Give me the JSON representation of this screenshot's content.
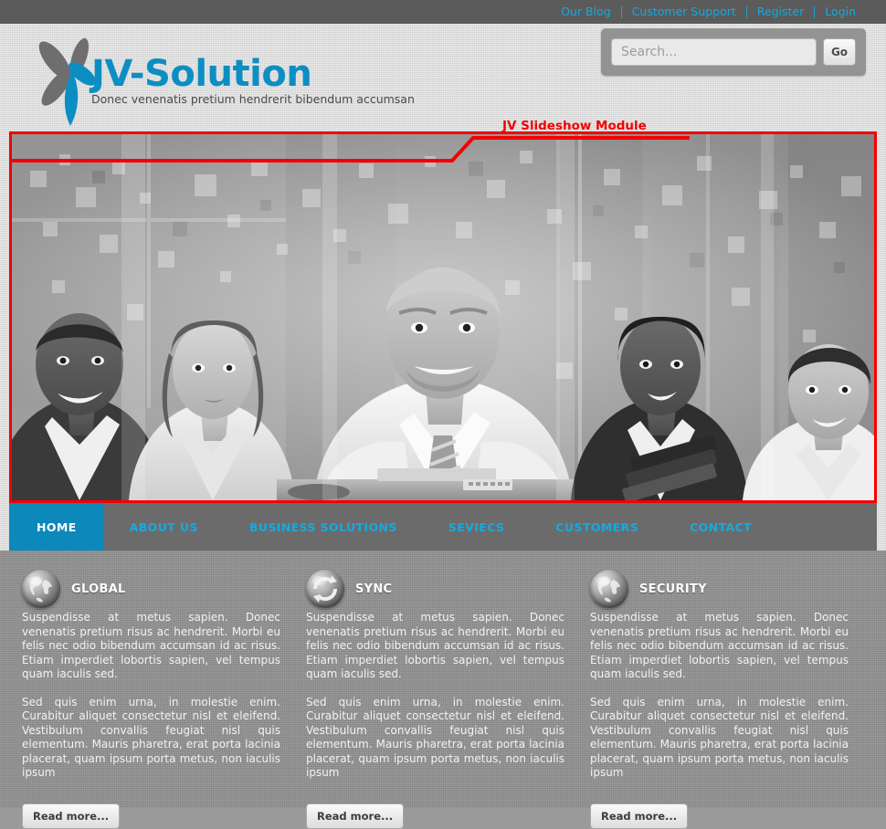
{
  "topbar": {
    "links": [
      {
        "label": "Our Blog"
      },
      {
        "label": "Customer Support"
      },
      {
        "label": "Register"
      },
      {
        "label": "Login"
      }
    ]
  },
  "header": {
    "logo": {
      "title": "JV-Solution",
      "tagline": "Donec venenatis pretium hendrerit bibendum accumsan",
      "icon": "flower-petal-logo",
      "petal_gray": "#6e6e6e",
      "petal_blue": "#0d8ec2"
    },
    "search": {
      "placeholder": "Search...",
      "value": "",
      "button_label": "Go"
    }
  },
  "annotation": {
    "label": "JV Slideshow Module",
    "color": "#f40000"
  },
  "slideshow": {
    "alt": "Grayscale business team photo with digital pixel overlay",
    "border_color": "#f40000"
  },
  "nav": {
    "active_color": "#0c88bb",
    "link_color": "#18a9de",
    "items": [
      {
        "label": "HOME",
        "active": true
      },
      {
        "label": "ABOUT US",
        "active": false
      },
      {
        "label": "BUSINESS SOLUTIONS",
        "active": false
      },
      {
        "label": "SEVIECS",
        "active": false
      },
      {
        "label": "CUSTOMERS",
        "active": false
      },
      {
        "label": "CONTACT",
        "active": false
      }
    ]
  },
  "columns": [
    {
      "title": "GLOBAL",
      "icon": "globe-icon",
      "p1": "Suspendisse at metus sapien. Donec venenatis pretium risus ac hendrerit. Morbi eu felis nec odio bibendum accumsan id ac risus. Etiam imperdiet lobortis sapien, vel tempus quam iaculis sed.",
      "p2": "Sed quis enim urna, in molestie enim. Curabitur aliquet consectetur nisl et eleifend. Vestibulum convallis feugiat nisl quis elementum. Mauris pharetra, erat porta lacinia placerat, quam ipsum porta metus, non iaculis ipsum",
      "button": "Read more..."
    },
    {
      "title": "SYNC",
      "icon": "sync-icon",
      "p1": "Suspendisse at metus sapien. Donec venenatis pretium risus ac hendrerit. Morbi eu felis nec odio bibendum accumsan id ac risus. Etiam imperdiet lobortis sapien, vel tempus quam iaculis sed.",
      "p2": "Sed quis enim urna, in molestie enim. Curabitur aliquet consectetur nisl et eleifend. Vestibulum convallis feugiat nisl quis elementum. Mauris pharetra, erat porta lacinia placerat, quam ipsum porta metus, non iaculis ipsum",
      "button": "Read more..."
    },
    {
      "title": "SECURITY",
      "icon": "globe-icon",
      "p1": "Suspendisse at metus sapien. Donec venenatis pretium risus ac hendrerit. Morbi eu felis nec odio bibendum accumsan id ac risus. Etiam imperdiet lobortis sapien, vel tempus quam iaculis sed.",
      "p2": "Sed quis enim urna, in molestie enim. Curabitur aliquet consectetur nisl et eleifend. Vestibulum convallis feugiat nisl quis elementum. Mauris pharetra, erat porta lacinia placerat, quam ipsum porta metus, non iaculis ipsum",
      "button": "Read more..."
    }
  ]
}
